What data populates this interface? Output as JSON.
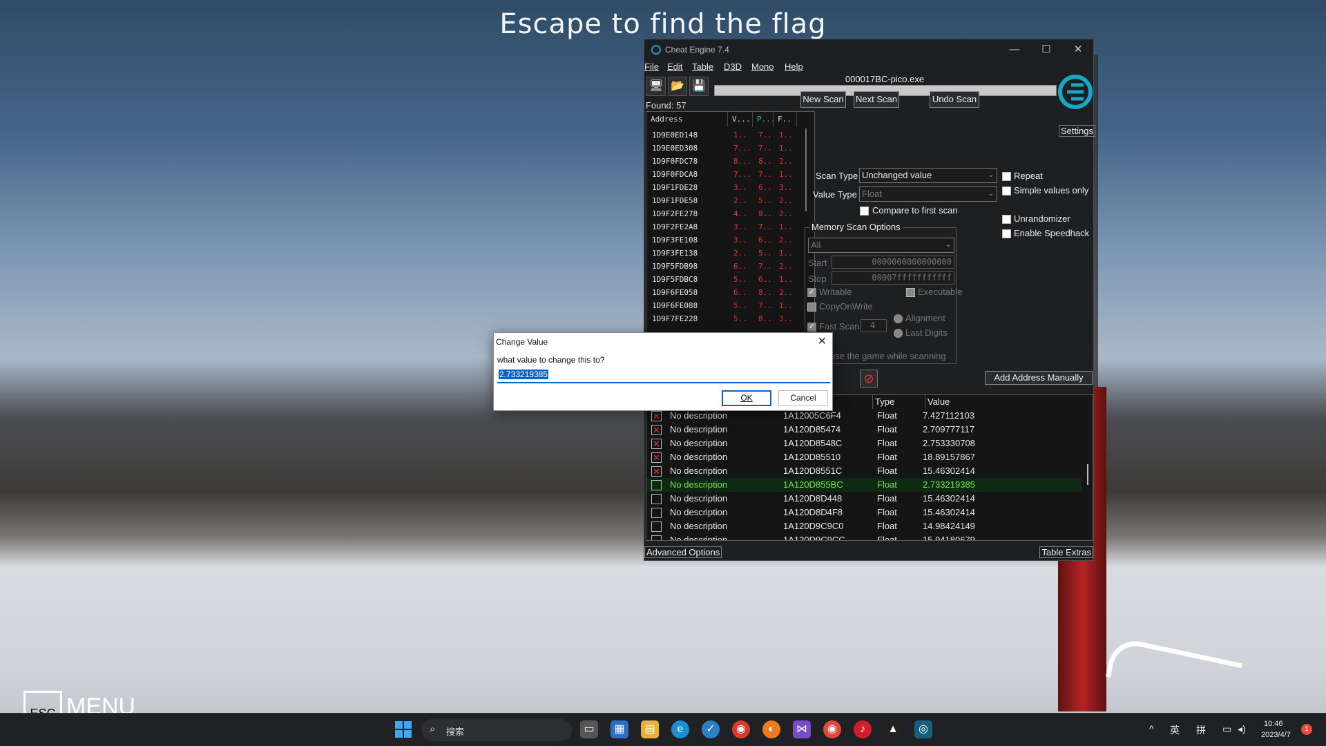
{
  "game": {
    "title": "Escape to find the flag",
    "esc_key": "ESC",
    "menu_label": "MENU"
  },
  "window": {
    "title": "Cheat Engine 7.4",
    "menu": [
      "File",
      "Edit",
      "Table",
      "D3D",
      "Mono",
      "Help"
    ],
    "process": "000017BC-pico.exe",
    "found": "Found: 57",
    "settings": "Settings",
    "toolbar_icons": [
      "open-process-icon",
      "open-file-icon",
      "save-icon"
    ]
  },
  "results": {
    "headers": [
      "Address",
      "V...",
      "P...",
      "F.."
    ],
    "rows": [
      {
        "addr": "1D9E0ED148",
        "v": "1..",
        "p": "7..",
        "f": "1.."
      },
      {
        "addr": "1D9E0ED308",
        "v": "7...",
        "p": "7..",
        "f": "1.."
      },
      {
        "addr": "1D9F0FDC78",
        "v": "8...",
        "p": "8..",
        "f": "2.."
      },
      {
        "addr": "1D9F0FDCA8",
        "v": "7...",
        "p": "7..",
        "f": "1.."
      },
      {
        "addr": "1D9F1FDE28",
        "v": "3..",
        "p": "6..",
        "f": "3.."
      },
      {
        "addr": "1D9F1FDE58",
        "v": "2..",
        "p": "5..",
        "f": "2.."
      },
      {
        "addr": "1D9F2FE278",
        "v": "4..",
        "p": "8..",
        "f": "2.."
      },
      {
        "addr": "1D9F2FE2A8",
        "v": "3..",
        "p": "7..",
        "f": "1.."
      },
      {
        "addr": "1D9F3FE108",
        "v": "3..",
        "p": "6..",
        "f": "2.."
      },
      {
        "addr": "1D9F3FE138",
        "v": "2..",
        "p": "5..",
        "f": "1.."
      },
      {
        "addr": "1D9F5FDB98",
        "v": "6..",
        "p": "7..",
        "f": "2.."
      },
      {
        "addr": "1D9F5FDBC8",
        "v": "5..",
        "p": "6..",
        "f": "1.."
      },
      {
        "addr": "1D9F6FE058",
        "v": "6..",
        "p": "8..",
        "f": "2.."
      },
      {
        "addr": "1D9F6FE088",
        "v": "5..",
        "p": "7..",
        "f": "1.."
      },
      {
        "addr": "1D9F7FE228",
        "v": "5..",
        "p": "8..",
        "f": "3.."
      }
    ]
  },
  "scan": {
    "new_scan": "New Scan",
    "next_scan": "Next Scan",
    "undo_scan": "Undo Scan",
    "scan_type_label": "Scan Type",
    "scan_type_value": "Unchanged value",
    "value_type_label": "Value Type",
    "value_type_value": "Float",
    "compare_first": "Compare to first scan",
    "repeat": "Repeat",
    "simple_values": "Simple values only",
    "unrandomizer": "Unrandomizer",
    "speedhack": "Enable Speedhack",
    "mem_options_title": "Memory Scan Options",
    "mem_region": "All",
    "start_label": "Start",
    "start_value": "0000000000000000",
    "stop_label": "Stop",
    "stop_value": "00007fffffffffff",
    "writable": "Writable",
    "executable": "Executable",
    "copy_on_write": "CopyOnWrite",
    "fast_scan": "Fast Scan",
    "fast_scan_value": "4",
    "alignment": "Alignment",
    "last_digits": "Last Digits",
    "pause_game": "Pause the game while scanning",
    "add_manual": "Add Address Manually"
  },
  "table": {
    "headers": [
      "Type",
      "Value"
    ],
    "rows": [
      {
        "desc": "No description",
        "addr": "1A12005C6F4",
        "type": "Float",
        "value": "7.427112103",
        "frozen": true
      },
      {
        "desc": "No description",
        "addr": "1A120D85474",
        "type": "Float",
        "value": "2.709777117",
        "frozen": true
      },
      {
        "desc": "No description",
        "addr": "1A120D8548C",
        "type": "Float",
        "value": "2.753330708",
        "frozen": true
      },
      {
        "desc": "No description",
        "addr": "1A120D85510",
        "type": "Float",
        "value": "18.89157867",
        "frozen": true
      },
      {
        "desc": "No description",
        "addr": "1A120D8551C",
        "type": "Float",
        "value": "15.46302414",
        "frozen": true
      },
      {
        "desc": "No description",
        "addr": "1A120D855BC",
        "type": "Float",
        "value": "2.733219385",
        "frozen": false,
        "selected": true
      },
      {
        "desc": "No description",
        "addr": "1A120D8D448",
        "type": "Float",
        "value": "15.46302414",
        "frozen": false
      },
      {
        "desc": "No description",
        "addr": "1A120D8D4F8",
        "type": "Float",
        "value": "15.46302414",
        "frozen": false
      },
      {
        "desc": "No description",
        "addr": "1A120D9C9C0",
        "type": "Float",
        "value": "14.98424149",
        "frozen": false
      },
      {
        "desc": "No description",
        "addr": "1A120D9C9CC",
        "type": "Float",
        "value": "15.94180679",
        "frozen": false
      }
    ],
    "advanced": "Advanced Options",
    "extras": "Table Extras"
  },
  "dialog": {
    "title": "Change Value",
    "question": "what value to change this to?",
    "value": "2.733219385",
    "ok": "OK",
    "cancel": "Cancel"
  },
  "taskbar": {
    "search_placeholder": "搜索",
    "ime_lang": "英",
    "ime_mode": "拼",
    "time": "10:46",
    "date": "2023/4/7",
    "notifications": "1"
  }
}
